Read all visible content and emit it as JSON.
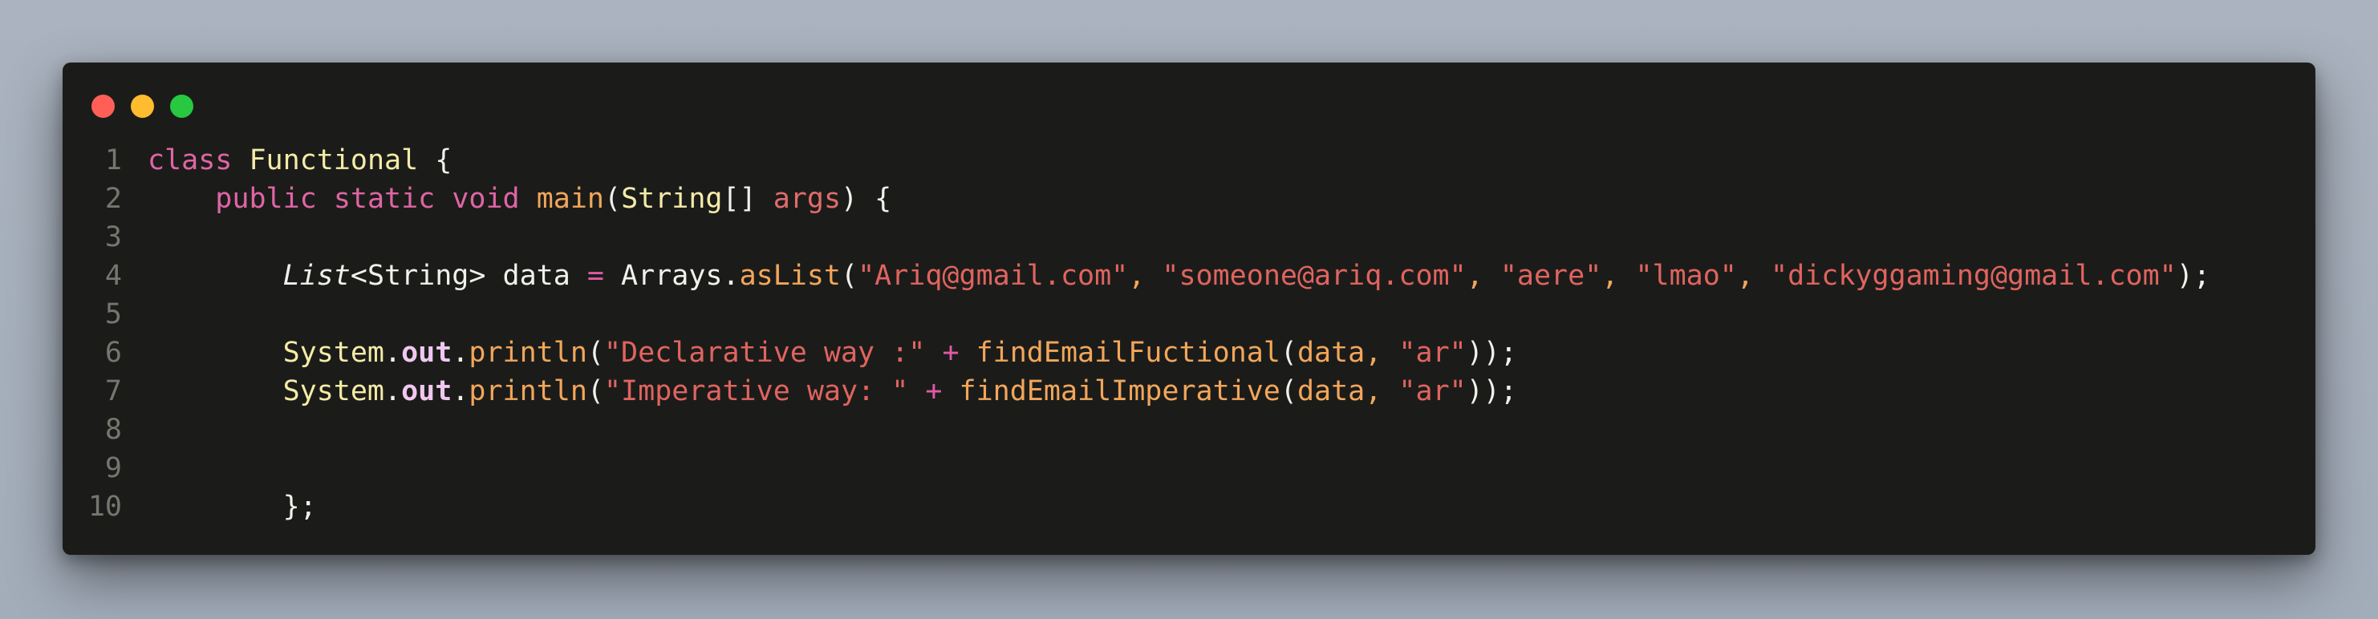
{
  "window": {
    "buttons": {
      "close_color": "#ff5f57",
      "minimize_color": "#febc2e",
      "maximize_color": "#28c840"
    }
  },
  "editor": {
    "theme_colors": {
      "background": "#1b1c1a",
      "keyword": "#e065a4",
      "string": "#e0645f",
      "function": "#f2a65a",
      "class_name": "#f5eba7",
      "line_number": "#75766e"
    },
    "lines": [
      {
        "number": "1",
        "tokens": [
          {
            "text": "class",
            "kind": "kw"
          },
          {
            "text": " ",
            "kind": "plain"
          },
          {
            "text": "Functional",
            "kind": "cls"
          },
          {
            "text": " {",
            "kind": "punct"
          }
        ]
      },
      {
        "number": "2",
        "tokens": [
          {
            "text": "    ",
            "kind": "plain"
          },
          {
            "text": "public",
            "kind": "kw"
          },
          {
            "text": " ",
            "kind": "plain"
          },
          {
            "text": "static",
            "kind": "kw"
          },
          {
            "text": " ",
            "kind": "plain"
          },
          {
            "text": "void",
            "kind": "kw"
          },
          {
            "text": " ",
            "kind": "plain"
          },
          {
            "text": "main",
            "kind": "fn"
          },
          {
            "text": "(",
            "kind": "punct"
          },
          {
            "text": "String",
            "kind": "cls"
          },
          {
            "text": "[] ",
            "kind": "plain"
          },
          {
            "text": "args",
            "kind": "param"
          },
          {
            "text": ") {",
            "kind": "punct"
          }
        ]
      },
      {
        "number": "3",
        "tokens": []
      },
      {
        "number": "4",
        "tokens": [
          {
            "text": "        ",
            "kind": "plain"
          },
          {
            "text": "List",
            "kind": "type"
          },
          {
            "text": "<String> data ",
            "kind": "plain"
          },
          {
            "text": "=",
            "kind": "op"
          },
          {
            "text": " Arrays",
            "kind": "plain"
          },
          {
            "text": ".",
            "kind": "punct"
          },
          {
            "text": "asList",
            "kind": "fn"
          },
          {
            "text": "(",
            "kind": "punct"
          },
          {
            "text": "\"Ariq@gmail.com\"",
            "kind": "str"
          },
          {
            "text": ", ",
            "kind": "fn"
          },
          {
            "text": "\"someone@ariq.com\"",
            "kind": "str"
          },
          {
            "text": ", ",
            "kind": "fn"
          },
          {
            "text": "\"aere\"",
            "kind": "str"
          },
          {
            "text": ", ",
            "kind": "fn"
          },
          {
            "text": "\"lmao\"",
            "kind": "str"
          },
          {
            "text": ", ",
            "kind": "fn"
          },
          {
            "text": "\"dickyggaming@gmail.com\"",
            "kind": "str"
          },
          {
            "text": ");",
            "kind": "punct"
          }
        ]
      },
      {
        "number": "5",
        "tokens": []
      },
      {
        "number": "6",
        "tokens": [
          {
            "text": "        ",
            "kind": "plain"
          },
          {
            "text": "System",
            "kind": "cls"
          },
          {
            "text": ".",
            "kind": "punct"
          },
          {
            "text": "out",
            "kind": "field"
          },
          {
            "text": ".",
            "kind": "punct"
          },
          {
            "text": "println",
            "kind": "fn"
          },
          {
            "text": "(",
            "kind": "punct"
          },
          {
            "text": "\"Declarative way :\"",
            "kind": "str"
          },
          {
            "text": " ",
            "kind": "plain"
          },
          {
            "text": "+",
            "kind": "op"
          },
          {
            "text": " ",
            "kind": "plain"
          },
          {
            "text": "findEmailFuctional",
            "kind": "fn"
          },
          {
            "text": "(",
            "kind": "punct"
          },
          {
            "text": "data",
            "kind": "fn"
          },
          {
            "text": ", ",
            "kind": "fn"
          },
          {
            "text": "\"ar\"",
            "kind": "str"
          },
          {
            "text": "));",
            "kind": "punct"
          }
        ]
      },
      {
        "number": "7",
        "tokens": [
          {
            "text": "        ",
            "kind": "plain"
          },
          {
            "text": "System",
            "kind": "cls"
          },
          {
            "text": ".",
            "kind": "punct"
          },
          {
            "text": "out",
            "kind": "field"
          },
          {
            "text": ".",
            "kind": "punct"
          },
          {
            "text": "println",
            "kind": "fn"
          },
          {
            "text": "(",
            "kind": "punct"
          },
          {
            "text": "\"Imperative way: \"",
            "kind": "str"
          },
          {
            "text": " ",
            "kind": "plain"
          },
          {
            "text": "+",
            "kind": "op"
          },
          {
            "text": " ",
            "kind": "plain"
          },
          {
            "text": "findEmailImperative",
            "kind": "fn"
          },
          {
            "text": "(",
            "kind": "punct"
          },
          {
            "text": "data",
            "kind": "fn"
          },
          {
            "text": ", ",
            "kind": "fn"
          },
          {
            "text": "\"ar\"",
            "kind": "str"
          },
          {
            "text": "));",
            "kind": "punct"
          }
        ]
      },
      {
        "number": "8",
        "tokens": []
      },
      {
        "number": "9",
        "tokens": []
      },
      {
        "number": "10",
        "tokens": [
          {
            "text": "        ",
            "kind": "plain"
          },
          {
            "text": "};",
            "kind": "punct"
          }
        ]
      }
    ]
  }
}
